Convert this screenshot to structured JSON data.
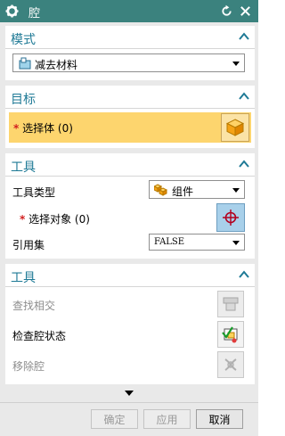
{
  "titlebar": {
    "title": "腔"
  },
  "mode_section": {
    "title": "模式",
    "mode_value": "减去材料"
  },
  "target_section": {
    "title": "目标",
    "select_body_label": "选择体 (0)",
    "required_mark": "*"
  },
  "tool_section": {
    "title": "工具",
    "tool_type_label": "工具类型",
    "tool_type_value": "组件",
    "select_object_label": "选择对象 (0)",
    "reference_set_label": "引用集",
    "reference_set_value": "FALSE",
    "required_mark": "*"
  },
  "tool_section2": {
    "title": "工具",
    "find_intersect_label": "查找相交",
    "check_cavity_label": "检查腔状态",
    "remove_cavity_label": "移除腔"
  },
  "footer": {
    "ok_label": "确定",
    "apply_label": "应用",
    "cancel_label": "取消"
  },
  "colors": {
    "titlebar": "#3b827e",
    "section_title": "#1f7a96",
    "highlight": "#fdd56e"
  }
}
